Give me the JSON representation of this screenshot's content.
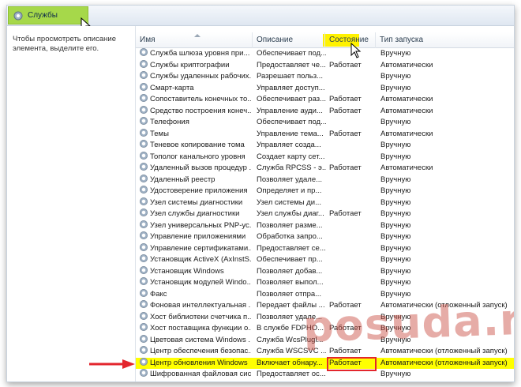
{
  "window": {
    "tab_title": "Службы",
    "left_pane_text": "Чтобы просмотреть описание элемента, выделите его."
  },
  "columns": [
    {
      "label": "Имя"
    },
    {
      "label": "Описание"
    },
    {
      "label": "Состояние"
    },
    {
      "label": "Тип запуска"
    }
  ],
  "rows": [
    {
      "name": "Служба шлюза уровня при...",
      "desc": "Обеспечивает под...",
      "state": "",
      "start": "Вручную"
    },
    {
      "name": "Службы криптографии",
      "desc": "Предоставляет че...",
      "state": "Работает",
      "start": "Автоматически"
    },
    {
      "name": "Службы удаленных рабочих...",
      "desc": "Разрешает польз...",
      "state": "",
      "start": "Вручную"
    },
    {
      "name": "Смарт-карта",
      "desc": "Управляет доступ...",
      "state": "",
      "start": "Вручную"
    },
    {
      "name": "Сопоставитель конечных то...",
      "desc": "Обеспечивает раз...",
      "state": "Работает",
      "start": "Автоматически"
    },
    {
      "name": "Средство построения конеч...",
      "desc": "Управление ауди...",
      "state": "Работает",
      "start": "Автоматически"
    },
    {
      "name": "Телефония",
      "desc": "Обеспечивает под...",
      "state": "",
      "start": "Вручную"
    },
    {
      "name": "Темы",
      "desc": "Управление тема...",
      "state": "Работает",
      "start": "Автоматически"
    },
    {
      "name": "Теневое копирование тома",
      "desc": "Управляет созда...",
      "state": "",
      "start": "Вручную"
    },
    {
      "name": "Тополог канального уровня",
      "desc": "Создает карту сет...",
      "state": "",
      "start": "Вручную"
    },
    {
      "name": "Удаленный вызов процедур ...",
      "desc": "Служба RPCSS - э...",
      "state": "Работает",
      "start": "Автоматически"
    },
    {
      "name": "Удаленный реестр",
      "desc": "Позволяет удале...",
      "state": "",
      "start": "Вручную"
    },
    {
      "name": "Удостоверение приложения",
      "desc": "Определяет и пр...",
      "state": "",
      "start": "Вручную"
    },
    {
      "name": "Узел системы диагностики",
      "desc": "Узел системы ди...",
      "state": "",
      "start": "Вручную"
    },
    {
      "name": "Узел службы диагностики",
      "desc": "Узел службы диаг...",
      "state": "Работает",
      "start": "Вручную"
    },
    {
      "name": "Узел универсальных PNP-ус...",
      "desc": "Позволяет разме...",
      "state": "",
      "start": "Вручную"
    },
    {
      "name": "Управление приложениями",
      "desc": "Обработка запро...",
      "state": "",
      "start": "Вручную"
    },
    {
      "name": "Управление сертификатами...",
      "desc": "Предоставляет се...",
      "state": "",
      "start": "Вручную"
    },
    {
      "name": "Установщик ActiveX (AxInstS...",
      "desc": "Обеспечивает пр...",
      "state": "",
      "start": "Вручную"
    },
    {
      "name": "Установщик Windows",
      "desc": "Позволяет добав...",
      "state": "",
      "start": "Вручную"
    },
    {
      "name": "Установщик модулей Windo...",
      "desc": "Позволяет выпол...",
      "state": "",
      "start": "Вручную"
    },
    {
      "name": "Факс",
      "desc": "Позволяет отпра...",
      "state": "",
      "start": "Вручную"
    },
    {
      "name": "Фоновая интеллектуальная ...",
      "desc": "Передает файлы ...",
      "state": "Работает",
      "start": "Автоматически (отложенный запуск)"
    },
    {
      "name": "Хост библиотеки счетчика п...",
      "desc": "Позволяет удале...",
      "state": "",
      "start": "Вручную"
    },
    {
      "name": "Хост поставщика функции о...",
      "desc": "В службе FDPHO...",
      "state": "Работает",
      "start": "Вручную"
    },
    {
      "name": "Цветовая система Windows ...",
      "desc": "Служба WcsPlugl...",
      "state": "",
      "start": "Вручную"
    },
    {
      "name": "Центр обеспечения безопас...",
      "desc": "Служба WSCSVC ...",
      "state": "Работает",
      "start": "Автоматически (отложенный запуск)"
    },
    {
      "name": "Центр обновления Windows",
      "desc": "Включает обнару...",
      "state": "Работает",
      "start": "Автоматически (отложенный запуск)",
      "highlight": true
    },
    {
      "name": "Шифрованная файловая сис...",
      "desc": "Предоставляет ос...",
      "state": "",
      "start": "Вручную"
    }
  ],
  "annotations": {
    "header_highlight_color": "#fff200",
    "row_highlight_color": "#ffff00",
    "marker_color": "#e3262d",
    "watermark_text": "posuda.ru"
  }
}
